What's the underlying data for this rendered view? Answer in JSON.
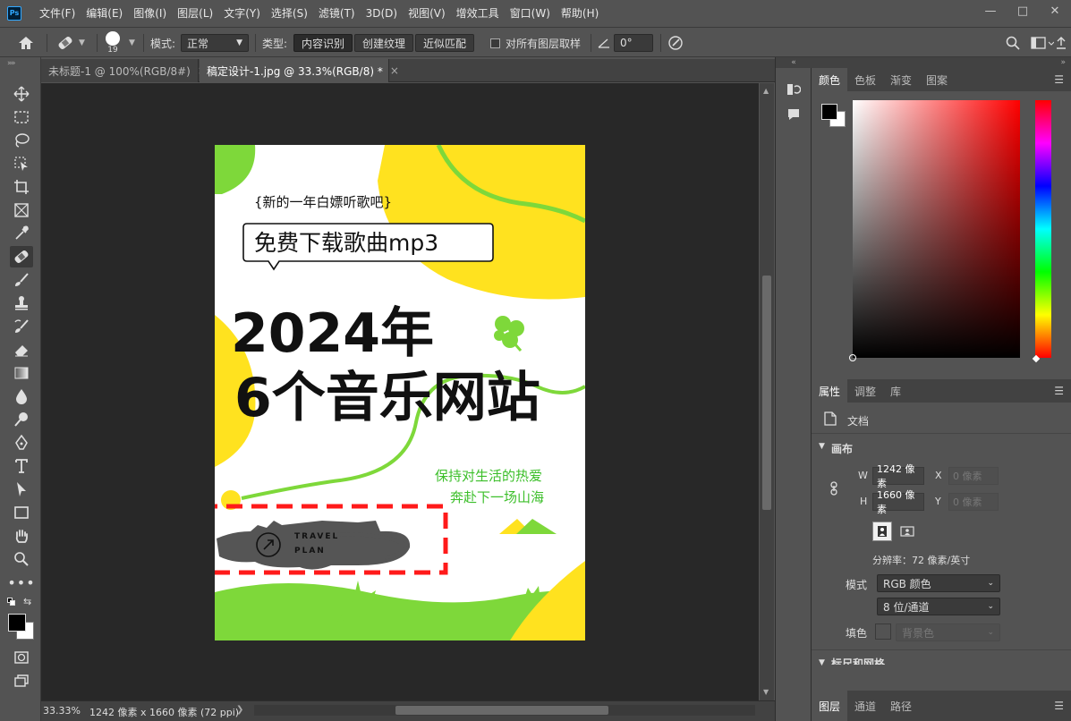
{
  "app": {
    "logo": "Ps"
  },
  "menu": [
    "文件(F)",
    "编辑(E)",
    "图像(I)",
    "图层(L)",
    "文字(Y)",
    "选择(S)",
    "滤镜(T)",
    "3D(D)",
    "视图(V)",
    "增效工具",
    "窗口(W)",
    "帮助(H)"
  ],
  "window_controls": {
    "minimize": "—",
    "restore": "□",
    "close": "✕"
  },
  "options": {
    "brush_size": "19",
    "mode_label": "模式:",
    "mode_value": "正常",
    "type_label": "类型:",
    "type_buttons": [
      "内容识别",
      "创建纹理",
      "近似匹配"
    ],
    "type_selected": "内容识别",
    "sample_all_label": "对所有图层取样",
    "angle_value": "0°"
  },
  "tabs": [
    {
      "label": "未标题-1 @ 100%(RGB/8#)",
      "close": "×",
      "active": false
    },
    {
      "label": "稿定设计-1.jpg @ 33.3%(RGB/8) *",
      "close": "×",
      "active": true
    }
  ],
  "poster": {
    "subtitle": "{新的一年白嫖听歌吧}",
    "bubble": "免费下载歌曲mp3",
    "headline1": "2024年",
    "headline2": "6个音乐网站",
    "slogan1": "保持对生活的热爱",
    "slogan2": "奔赴下一场山海",
    "logo_line1": "TRAVEL",
    "logo_line2": "PLAN"
  },
  "status": {
    "zoom": "33.33%",
    "doc_info": "1242 像素 x 1660 像素 (72 ppi)",
    "arrow": "❯"
  },
  "panels": {
    "color_tabs": [
      "颜色",
      "色板",
      "渐变",
      "图案"
    ],
    "props_tabs": [
      "属性",
      "调整",
      "库"
    ],
    "bottom_tabs": [
      "图层",
      "通道",
      "路径"
    ],
    "doc_label": "文档",
    "canvas_section": "画布",
    "w_label": "W",
    "w_value": "1242 像素",
    "h_label": "H",
    "h_value": "1660 像素",
    "x_label": "X",
    "x_placeholder": "0 像素",
    "y_label": "Y",
    "y_placeholder": "0 像素",
    "resolution": "分辨率：72 像素/英寸",
    "mode_label": "模式",
    "mode_value": "RGB 颜色",
    "depth_value": "8 位/通道",
    "fill_label": "填色",
    "fill_value": "背景色",
    "rulers_section": "标尺和网格"
  },
  "colors": {
    "accent_green": "#7ed83a",
    "accent_yellow": "#ffe21f",
    "red_dash": "#ff1a1a"
  }
}
